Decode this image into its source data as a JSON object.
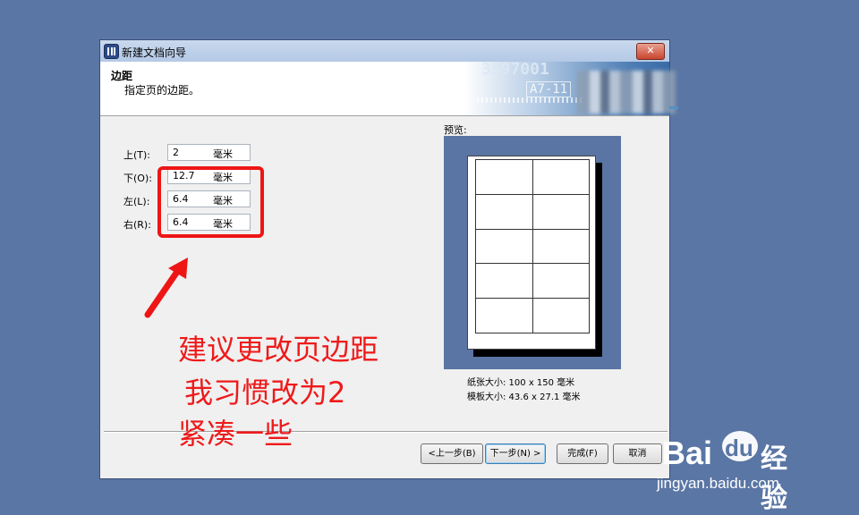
{
  "window": {
    "title": "新建文档向导",
    "close_label": "✕"
  },
  "header": {
    "title": "边距",
    "subtitle": "指定页的边距。",
    "banner_text_1": "3597001",
    "banner_text_2": "A7-11"
  },
  "margins": [
    {
      "label": "上(T):",
      "value": "2",
      "unit": "毫米"
    },
    {
      "label": "下(O):",
      "value": "12.7",
      "unit": "毫米"
    },
    {
      "label": "左(L):",
      "value": "6.4",
      "unit": "毫米"
    },
    {
      "label": "右(R):",
      "value": "6.4",
      "unit": "毫米"
    }
  ],
  "preview": {
    "label": "预览:",
    "paper_size": "纸张大小: 100 x 150 毫米",
    "template_size": "模板大小: 43.6 x 27.1 毫米",
    "grid_rows": 5,
    "grid_cols": 2
  },
  "buttons": {
    "back": "<上一步(B)",
    "next": "下一步(N) >",
    "finish": "完成(F)",
    "cancel": "取消"
  },
  "annotation": {
    "line1": "建议更改页边距",
    "line2": "我习惯改为2",
    "line3": "紧凑一些",
    "color": "#ee1a1a"
  },
  "watermark": {
    "brand_a": "Bai",
    "brand_b": "du",
    "brand_c": "经验",
    "url": "jingyan.baidu.com"
  },
  "colors": {
    "desktop": "#5a76a5",
    "preview_bg": "#5a74a3"
  }
}
